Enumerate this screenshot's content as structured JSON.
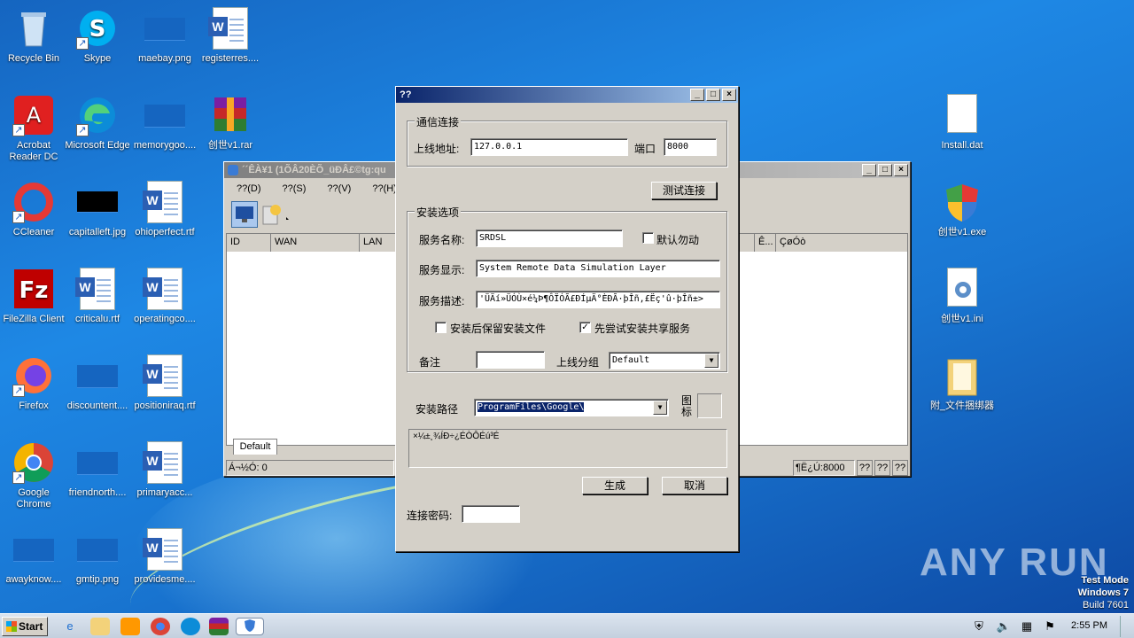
{
  "desktop": {
    "icons_col1": [
      {
        "label": "Recycle Bin",
        "icon": "recycle-bin-icon"
      },
      {
        "label": "Acrobat Reader DC",
        "icon": "acrobat-icon"
      },
      {
        "label": "CCleaner",
        "icon": "ccleaner-icon"
      },
      {
        "label": "FileZilla Client",
        "icon": "filezilla-icon"
      },
      {
        "label": "Firefox",
        "icon": "firefox-icon"
      },
      {
        "label": "Google Chrome",
        "icon": "chrome-icon"
      },
      {
        "label": "awayknow....",
        "icon": "image-file-icon"
      }
    ],
    "icons_col2": [
      {
        "label": "Skype",
        "icon": "skype-icon"
      },
      {
        "label": "Microsoft Edge",
        "icon": "edge-icon"
      },
      {
        "label": "capitalleft.jpg",
        "icon": "image-file-icon"
      },
      {
        "label": "criticalu.rtf",
        "icon": "word-doc-icon"
      },
      {
        "label": "discountent....",
        "icon": "image-file-icon"
      },
      {
        "label": "friendnorth....",
        "icon": "image-file-icon"
      },
      {
        "label": "gmtip.png",
        "icon": "image-file-icon"
      }
    ],
    "icons_col3": [
      {
        "label": "maebay.png",
        "icon": "image-file-icon"
      },
      {
        "label": "memorygoo....",
        "icon": "image-file-icon"
      },
      {
        "label": "ohioperfect.rtf",
        "icon": "word-doc-icon"
      },
      {
        "label": "operatingco....",
        "icon": "word-doc-icon"
      },
      {
        "label": "positioniraq.rtf",
        "icon": "word-doc-icon"
      },
      {
        "label": "primaryacc...",
        "icon": "word-doc-icon"
      },
      {
        "label": "providesme....",
        "icon": "word-doc-icon"
      }
    ],
    "icons_col4": [
      {
        "label": "registerres....",
        "icon": "word-doc-icon"
      },
      {
        "label": "创世v1.rar",
        "icon": "winrar-icon"
      }
    ],
    "icons_right": [
      {
        "label": "Install.dat",
        "icon": "blank-file-icon"
      },
      {
        "label": "创世v1.exe",
        "icon": "shield-exe-icon"
      },
      {
        "label": "创世v1.ini",
        "icon": "config-file-icon"
      },
      {
        "label": "附_文件捆绑器",
        "icon": "folder-icon"
      }
    ]
  },
  "bg_window": {
    "title": "´´ÊÀ¥1 (1ÕÂ20ÈÕ_üÐÂ£©tg:qu",
    "menu": [
      "??(D)",
      "??(S)",
      "??(V)",
      "??(H)"
    ],
    "columns": [
      "ID",
      "WAN",
      "LAN",
      "Ê...",
      "ÇøÓò"
    ],
    "tab": "Default",
    "status_left": "Á¬½Ó: 0",
    "status_port": "¶Ë¿Ú:8000",
    "status_boxes": [
      "??",
      "??",
      "??"
    ]
  },
  "dialog": {
    "title": "??",
    "comm_group": "通信连接",
    "host_label": "上线地址:",
    "host_value": "127.0.0.1",
    "port_label": "端口",
    "port_value": "8000",
    "test_button": "测试连接",
    "install_group": "安装选项",
    "svc_name_label": "服务名称:",
    "svc_name_value": "SRDSL",
    "default_checkbox": "默认勿动",
    "svc_display_label": "服务显示:",
    "svc_display_value": "System Remote Data Simulation Layer",
    "svc_desc_label": "服务描述:",
    "svc_desc_value": "'ÜÄí»ÜÓÙ×é¼Þ¶ÔÏÓÃ£ÐÍµÄ°ÈÐÃ·þÎñ,£Ëç'û·þÎñ±>",
    "keep_files_checkbox": "安装后保留安装文件",
    "try_shared_checkbox": "先尝试安装共享服务",
    "note_label": "备注",
    "group_label": "上线分组",
    "group_value": "Default",
    "path_label": "安装路径",
    "path_value": "ProgramFiles\\Google\\",
    "icon_label": "图标",
    "log_text": "×¼±¸¾ÍÐ÷¿ÉÒÔÉú³É",
    "generate_button": "生成",
    "cancel_button": "取消",
    "password_label": "连接密码:"
  },
  "taskbar": {
    "start_label": "Start",
    "clock": "2:55 PM"
  },
  "watermark": "ANY RUN",
  "test_mode": [
    "Test Mode",
    "Windows 7",
    "Build 7601"
  ]
}
